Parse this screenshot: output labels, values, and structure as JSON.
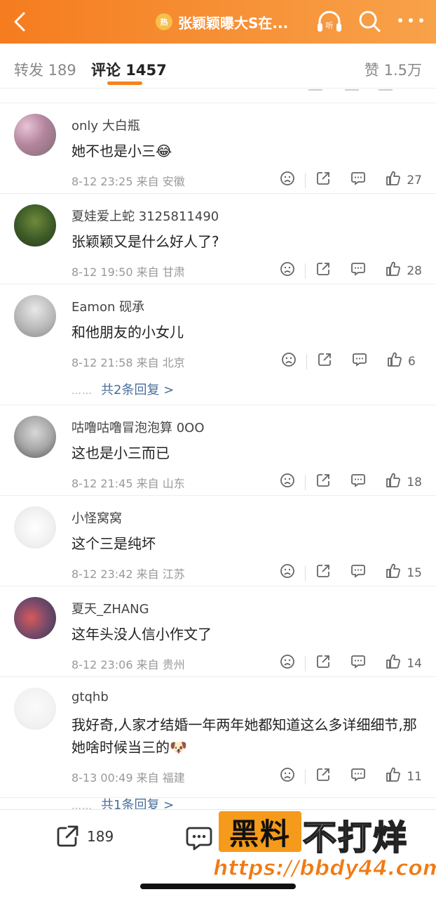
{
  "header": {
    "topic_badge": "热",
    "topic_title": "张颖颖曝大S在...",
    "listen_label": "听"
  },
  "tabs": {
    "repost": "转发 189",
    "comment": "评论 1457",
    "like": "赞 1.5万"
  },
  "comments": [
    {
      "name": "only 大白瓶",
      "text": "她不也是小三😂",
      "time": "8-12 23:25",
      "from": "来自 安徽",
      "likes": "27",
      "replies": ""
    },
    {
      "name": "夏娃爱上蛇 3125811490",
      "text": "张颖颖又是什么好人了?",
      "time": "8-12 19:50",
      "from": "来自 甘肃",
      "likes": "28",
      "replies": ""
    },
    {
      "name": "Eamon 砚承",
      "text": "和他朋友的小女儿",
      "time": "8-12 21:58",
      "from": "来自 北京",
      "likes": "6",
      "replies": "共2条回复 >"
    },
    {
      "name": "咕噜咕噜冒泡泡算 0OO",
      "text": "这也是小三而已",
      "time": "8-12 21:45",
      "from": "来自 山东",
      "likes": "18",
      "replies": ""
    },
    {
      "name": "小怪窝窝",
      "text": "这个三是纯坏",
      "time": "8-12 23:42",
      "from": "来自 江苏",
      "likes": "15",
      "replies": ""
    },
    {
      "name": "夏天_ZHANG",
      "text": "这年头没人信小作文了",
      "time": "8-12 23:06",
      "from": "来自 贵州",
      "likes": "14",
      "replies": ""
    },
    {
      "name": "gtqhb",
      "text": "我好奇,人家才结婚一年两年她都知道这么多详细细节,那她啥时候当三的🐶",
      "time": "8-13 00:49",
      "from": "来自 福建",
      "likes": "11",
      "replies": "共1条回复 >"
    }
  ],
  "reply_dots": "……",
  "bottom": {
    "share_count": "189"
  },
  "watermark": {
    "box": "黑料",
    "text": "不打烊",
    "url": "https://bbdy44.com"
  },
  "colors": {
    "accent": "#f5821f",
    "link": "#4a6f9a"
  }
}
